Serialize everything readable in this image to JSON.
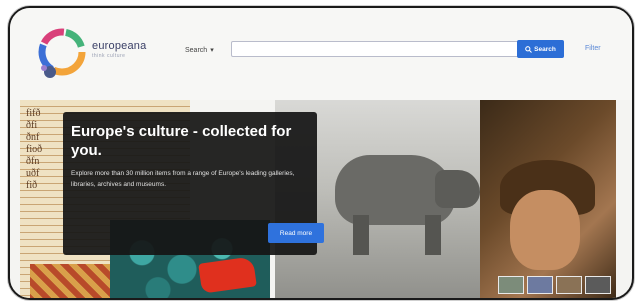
{
  "header": {
    "logo_word": "europeana",
    "logo_sub": "think culture",
    "search_select": "Search",
    "search_input": {
      "value": "",
      "placeholder": ""
    },
    "search_button": "Search",
    "filter_link": "Filter"
  },
  "hero": {
    "title": "Europe's culture - collected for you.",
    "text": "Explore more than 30 million items from a range of Europe's leading galleries, libraries, archives and museums.",
    "read_more": "Read more"
  },
  "icons": [
    "europeana-logo-icon",
    "chevron-down-icon",
    "search-icon"
  ],
  "colors": {
    "accent": "#2c6ed6",
    "overlay": "#161616",
    "brand": "#3a3f66"
  }
}
